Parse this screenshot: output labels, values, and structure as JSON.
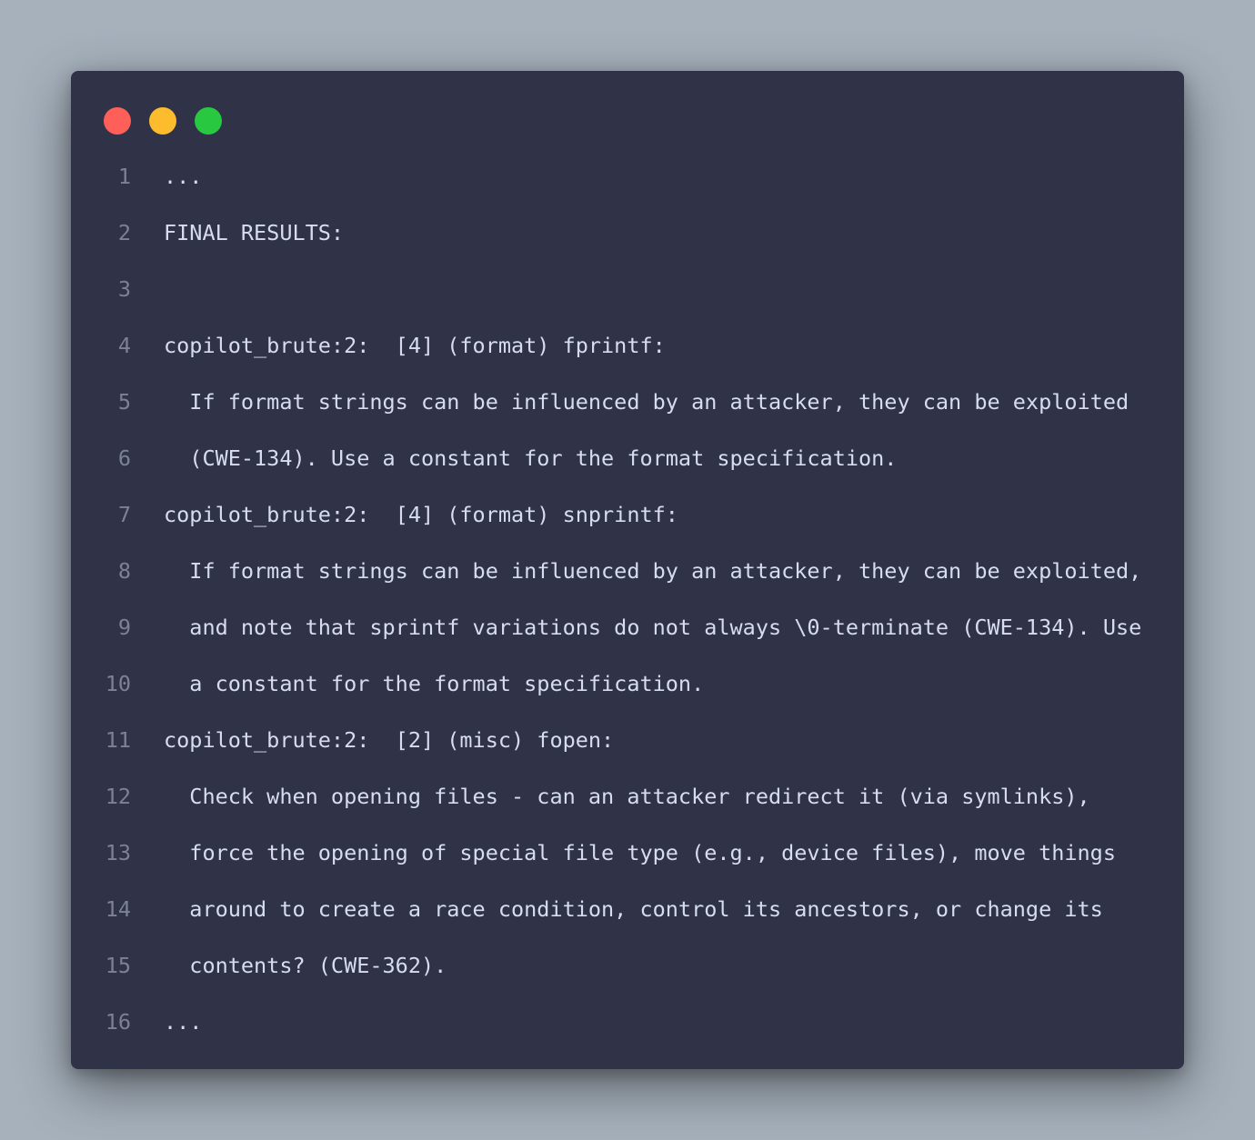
{
  "window": {
    "traffic_lights": {
      "close_color": "#fe5f58",
      "minimize_color": "#fdbc2e",
      "maximize_color": "#28c840"
    }
  },
  "code": {
    "lines": [
      {
        "number": "1",
        "text": "..."
      },
      {
        "number": "2",
        "text": "FINAL RESULTS:"
      },
      {
        "number": "3",
        "text": ""
      },
      {
        "number": "4",
        "text": "copilot_brute:2:  [4] (format) fprintf:"
      },
      {
        "number": "5",
        "text": "  If format strings can be influenced by an attacker, they can be exploited"
      },
      {
        "number": "6",
        "text": "  (CWE-134). Use a constant for the format specification."
      },
      {
        "number": "7",
        "text": "copilot_brute:2:  [4] (format) snprintf:"
      },
      {
        "number": "8",
        "text": "  If format strings can be influenced by an attacker, they can be exploited,"
      },
      {
        "number": "9",
        "text": "  and note that sprintf variations do not always \\0-terminate (CWE-134). Use"
      },
      {
        "number": "10",
        "text": "  a constant for the format specification."
      },
      {
        "number": "11",
        "text": "copilot_brute:2:  [2] (misc) fopen:"
      },
      {
        "number": "12",
        "text": "  Check when opening files - can an attacker redirect it (via symlinks),"
      },
      {
        "number": "13",
        "text": "  force the opening of special file type (e.g., device files), move things"
      },
      {
        "number": "14",
        "text": "  around to create a race condition, control its ancestors, or change its"
      },
      {
        "number": "15",
        "text": "  contents? (CWE-362)."
      },
      {
        "number": "16",
        "text": "..."
      }
    ]
  }
}
